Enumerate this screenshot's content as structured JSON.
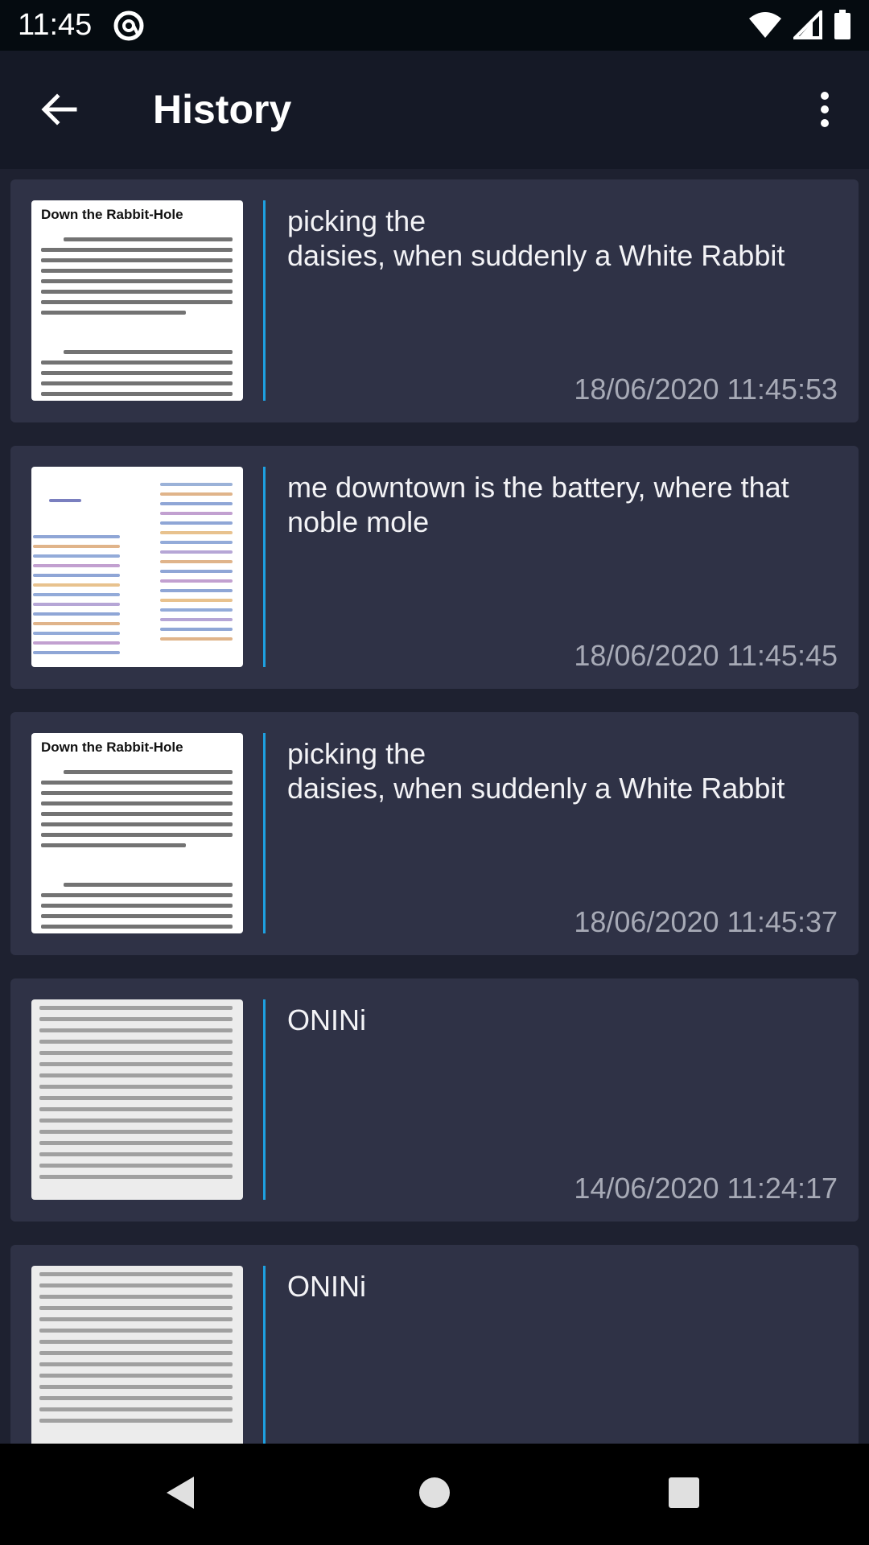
{
  "status_bar": {
    "time": "11:45"
  },
  "app_bar": {
    "title": "History"
  },
  "history": [
    {
      "text": "picking the\ndaisies, when suddenly a White Rabbit",
      "timestamp": "18/06/2020 11:45:53",
      "thumb_title": "Down the Rabbit-Hole"
    },
    {
      "text": "me downtown is the battery, where that noble mole",
      "timestamp": "18/06/2020 11:45:45",
      "thumb_title": ""
    },
    {
      "text": "picking the\ndaisies, when suddenly a White Rabbit",
      "timestamp": "18/06/2020 11:45:37",
      "thumb_title": "Down the Rabbit-Hole"
    },
    {
      "text": "ONINi",
      "timestamp": "14/06/2020 11:24:17",
      "thumb_title": ""
    },
    {
      "text": "ONINi",
      "timestamp": "",
      "thumb_title": ""
    }
  ],
  "colors": {
    "accent": "#1ea0e0",
    "card": "#2f3246",
    "background": "#1e2130",
    "app_bar": "#151926"
  }
}
